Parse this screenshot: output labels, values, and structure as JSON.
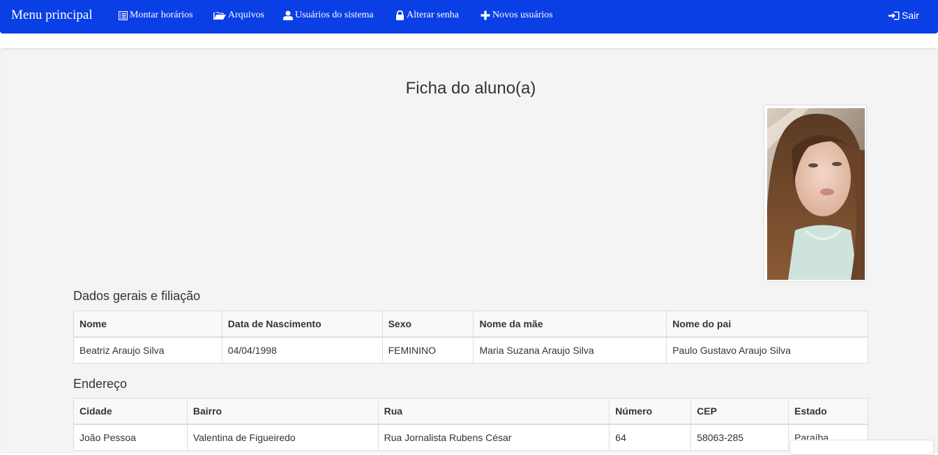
{
  "navbar": {
    "brand": "Menu principal",
    "items": [
      {
        "label": "Montar horários",
        "icon": "list-alt-icon"
      },
      {
        "label": "Arquivos",
        "icon": "folder-open-icon"
      },
      {
        "label": "Usuários do sistema",
        "icon": "user-icon"
      },
      {
        "label": "Alterar senha",
        "icon": "lock-icon"
      },
      {
        "label": "Novos usuários",
        "icon": "plus-icon"
      }
    ],
    "logout": {
      "label": "Sair",
      "icon": "log-in-icon"
    },
    "color": "#0a3fe6"
  },
  "page": {
    "title": "Ficha do aluno(a)"
  },
  "dados_gerais": {
    "title": "Dados gerais e filiação",
    "headers": [
      "Nome",
      "Data de Nascimento",
      "Sexo",
      "Nome da mãe",
      "Nome do pai"
    ],
    "row": [
      "Beatriz Araujo Silva",
      "04/04/1998",
      "FEMININO",
      "Maria Suzana Araujo Silva",
      "Paulo Gustavo Araujo Silva"
    ]
  },
  "endereco": {
    "title": "Endereço",
    "headers": [
      "Cidade",
      "Bairro",
      "Rua",
      "Número",
      "CEP",
      "Estado"
    ],
    "row": [
      "João Pessoa",
      "Valentina de Figueiredo",
      "Rua Jornalista Rubens César",
      "64",
      "58063-285",
      "Paraíba"
    ]
  }
}
